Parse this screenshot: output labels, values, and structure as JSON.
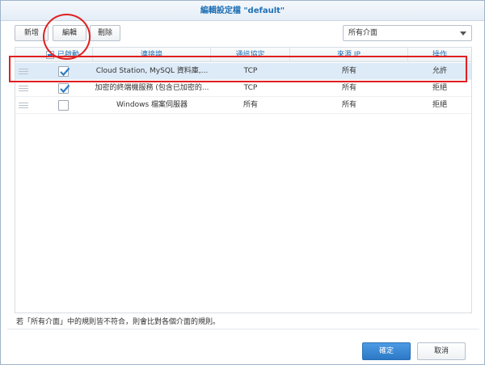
{
  "dialog": {
    "title": "編輯設定檔 \"default\""
  },
  "toolbar": {
    "add_label": "新增",
    "edit_label": "編輯",
    "delete_label": "刪除"
  },
  "interface_select": {
    "value": "所有介面"
  },
  "grid": {
    "columns": [
      "已啟動",
      "連接埠",
      "通訊協定",
      "來源 IP",
      "操作"
    ],
    "rows": [
      {
        "enabled": true,
        "port": "Cloud Station, MySQL 資料庫,...",
        "protocol": "TCP",
        "source_ip": "所有",
        "action": "允許",
        "selected": true
      },
      {
        "enabled": true,
        "port": "加密的終端機服務 (包含已加密的...",
        "protocol": "TCP",
        "source_ip": "所有",
        "action": "拒絕",
        "selected": false
      },
      {
        "enabled": false,
        "port": "Windows 檔案伺服器",
        "protocol": "所有",
        "source_ip": "所有",
        "action": "拒絕",
        "selected": false
      }
    ]
  },
  "footnote": "若「所有介面」中的規則皆不符合，則會比對各個介面的規則。",
  "footer": {
    "ok_label": "確定",
    "cancel_label": "取消"
  },
  "colors": {
    "accent": "#2c78c6",
    "highlight": "#e02020",
    "selected_row": "#ddebf8"
  }
}
